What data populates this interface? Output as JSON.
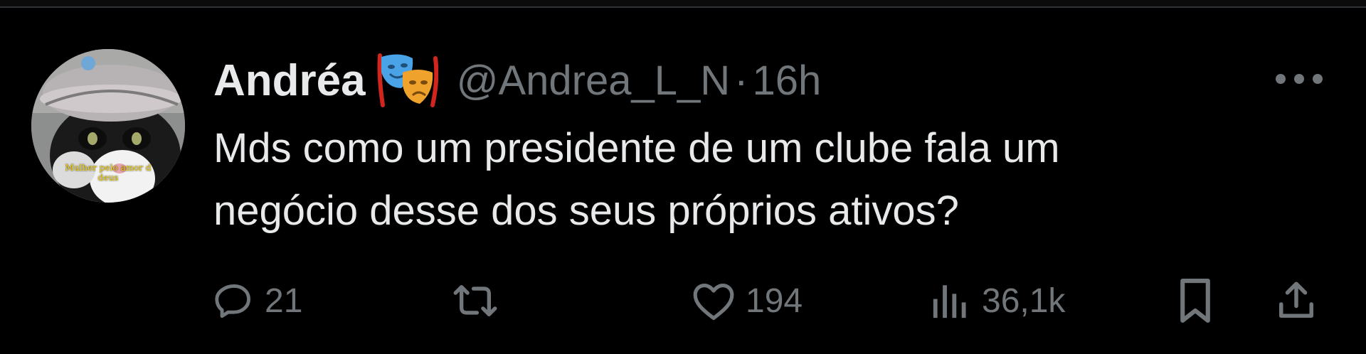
{
  "tweet": {
    "author": {
      "display_name": "Andréa",
      "badge_emoji": "performing-arts-emoji",
      "handle": "@Andrea_L_N",
      "separator": "·",
      "time": "16h",
      "avatar_caption_line1": "Mulher pelo amor d",
      "avatar_caption_line2": "deus"
    },
    "text_line1": "Mds como um presidente de um clube fala um",
    "text_line2": "negócio desse dos seus próprios ativos?",
    "actions": {
      "replies": "21",
      "reposts": "",
      "likes": "194",
      "views": "36,1k"
    }
  },
  "colors": {
    "background": "#000000",
    "primary_text": "#e7e9ea",
    "secondary_text": "#71767b",
    "divider": "#2f3336"
  },
  "icons": {
    "more": "more-horizontal-icon",
    "reply": "reply-bubble-icon",
    "repost": "repost-icon",
    "like": "heart-icon",
    "views": "analytics-bars-icon",
    "bookmark": "bookmark-icon",
    "share": "share-upload-icon"
  }
}
